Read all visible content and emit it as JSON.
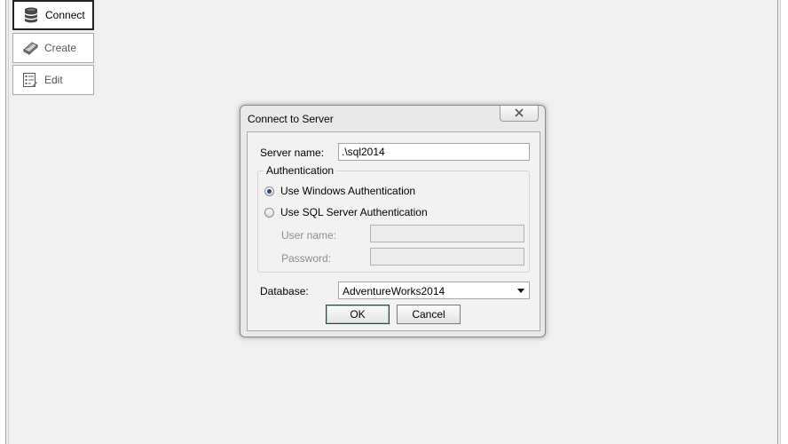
{
  "nav": {
    "connect": {
      "label": "Connect",
      "icon": "database-icon"
    },
    "create": {
      "label": "Create",
      "icon": "book-icon"
    },
    "edit": {
      "label": "Edit",
      "icon": "edit-list-icon"
    }
  },
  "dialog": {
    "title": "Connect to Server",
    "server_name_label": "Server name:",
    "server_name_value": ".\\sql2014",
    "authentication_legend": "Authentication",
    "windows_auth_label": "Use Windows Authentication",
    "sql_auth_label": "Use SQL Server Authentication",
    "selected_auth": "windows",
    "username_label": "User name:",
    "username_value": "",
    "password_label": "Password:",
    "password_value": "",
    "database_label": "Database:",
    "database_value": "AdventureWorks2014",
    "ok_label": "OK",
    "cancel_label": "Cancel"
  }
}
